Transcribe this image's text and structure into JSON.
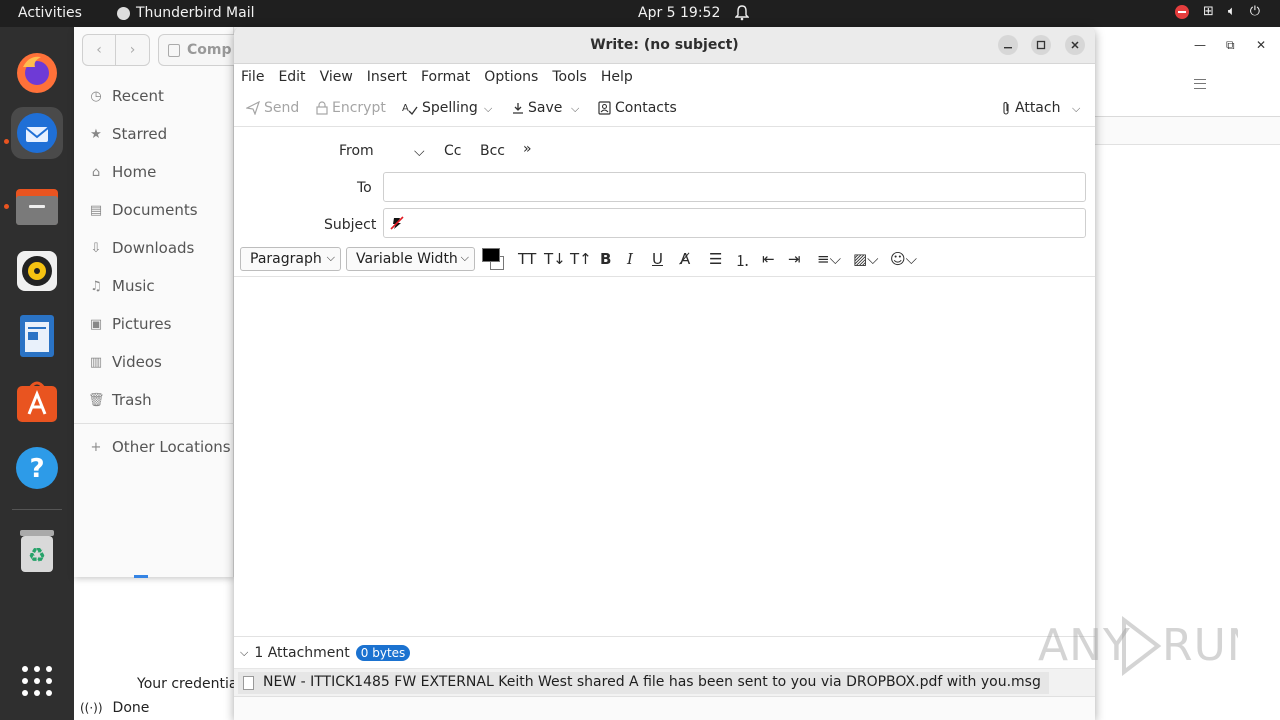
{
  "topbar": {
    "activities": "Activities",
    "app_name": "Thunderbird Mail",
    "clock": "Apr 5  19:52"
  },
  "files": {
    "path_label": "Comp",
    "sidebar": [
      {
        "label": "Recent",
        "icon": "clock-icon"
      },
      {
        "label": "Starred",
        "icon": "star-icon"
      },
      {
        "label": "Home",
        "icon": "home-icon"
      },
      {
        "label": "Documents",
        "icon": "document-icon"
      },
      {
        "label": "Downloads",
        "icon": "download-icon"
      },
      {
        "label": "Music",
        "icon": "music-icon"
      },
      {
        "label": "Pictures",
        "icon": "picture-icon"
      },
      {
        "label": "Videos",
        "icon": "video-icon"
      },
      {
        "label": "Trash",
        "icon": "trash-icon"
      }
    ],
    "other_locations": "Other Locations",
    "cred_text": "Your credentia",
    "status": "Done"
  },
  "compose": {
    "title": "Write: (no subject)",
    "menu": [
      "File",
      "Edit",
      "View",
      "Insert",
      "Format",
      "Options",
      "Tools",
      "Help"
    ],
    "toolbar": {
      "send": "Send",
      "encrypt": "Encrypt",
      "spelling": "Spelling",
      "save": "Save",
      "contacts": "Contacts",
      "attach": "Attach"
    },
    "headers": {
      "from": "From",
      "cc": "Cc",
      "bcc": "Bcc",
      "to": "To",
      "subject": "Subject",
      "to_value": "",
      "subject_value": ""
    },
    "format": {
      "paragraph": "Paragraph",
      "font": "Variable Width",
      "text_color": "#000000"
    },
    "attachments": {
      "count_label": "1 Attachment",
      "size": "0 bytes",
      "file": "NEW - ITTICK1485 FW EXTERNAL Keith West shared A file has been sent to you via DROPBOX.pdf with you.msg"
    }
  },
  "watermark": "ANY RUN"
}
